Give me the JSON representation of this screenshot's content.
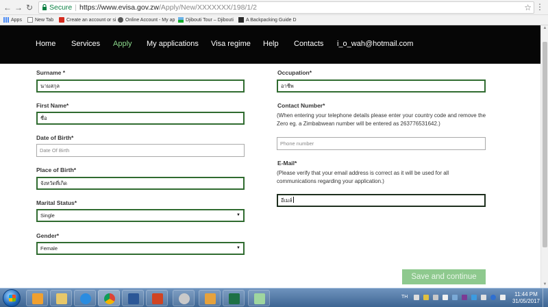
{
  "browser": {
    "secure_label": "Secure",
    "url_host": "https://www.evisa.gov.zw",
    "url_path": "/Apply/New/XXXXXXX/198/1/2",
    "bookmarks": [
      "Apps",
      "New Tab",
      "Create an account or si",
      "Online Account - My ap",
      "Djibouti Tour – Djibouti",
      "A Backpacking Guide D"
    ]
  },
  "site_nav": {
    "items": [
      "Home",
      "Services",
      "Apply",
      "My applications",
      "Visa regime",
      "Help",
      "Contacts",
      "i_o_wah@hotmail.com"
    ],
    "active": "Apply"
  },
  "form": {
    "surname": {
      "label": "Surname *",
      "value": "นามสกุล"
    },
    "first_name": {
      "label": "First Name*",
      "value": "ชื่อ"
    },
    "date_of_birth": {
      "label": "Date of Birth*",
      "placeholder": "Date Of Birth"
    },
    "place_of_birth": {
      "label": "Place of Birth*",
      "value": "จังหวัดที่เกิด"
    },
    "marital_status": {
      "label": "Marital Status*",
      "value": "Single"
    },
    "gender": {
      "label": "Gender*",
      "value": "Female"
    },
    "occupation": {
      "label": "Occupation*",
      "value": "อาชีพ"
    },
    "contact_number": {
      "label": "Contact Number*",
      "note": "(When entering your telephone details please enter your country code and remove the Zero eg. a Zimbabwean number will be entered as 263776531642.)",
      "placeholder": "Phone number"
    },
    "email": {
      "label": "E-Mail*",
      "note": "(Please verify that your email address is correct as it will be used for all communications regarding your application.)",
      "value": "อีเมล์"
    },
    "save_button": "Save and continue"
  },
  "taskbar": {
    "language": "TH",
    "time": "11:44 PM",
    "date": "31/05/2017"
  },
  "colors": {
    "header_bg": "#060606",
    "active_nav": "#8bd88b",
    "field_border": "#2f6b2f",
    "save_button": "#8ec98e"
  }
}
